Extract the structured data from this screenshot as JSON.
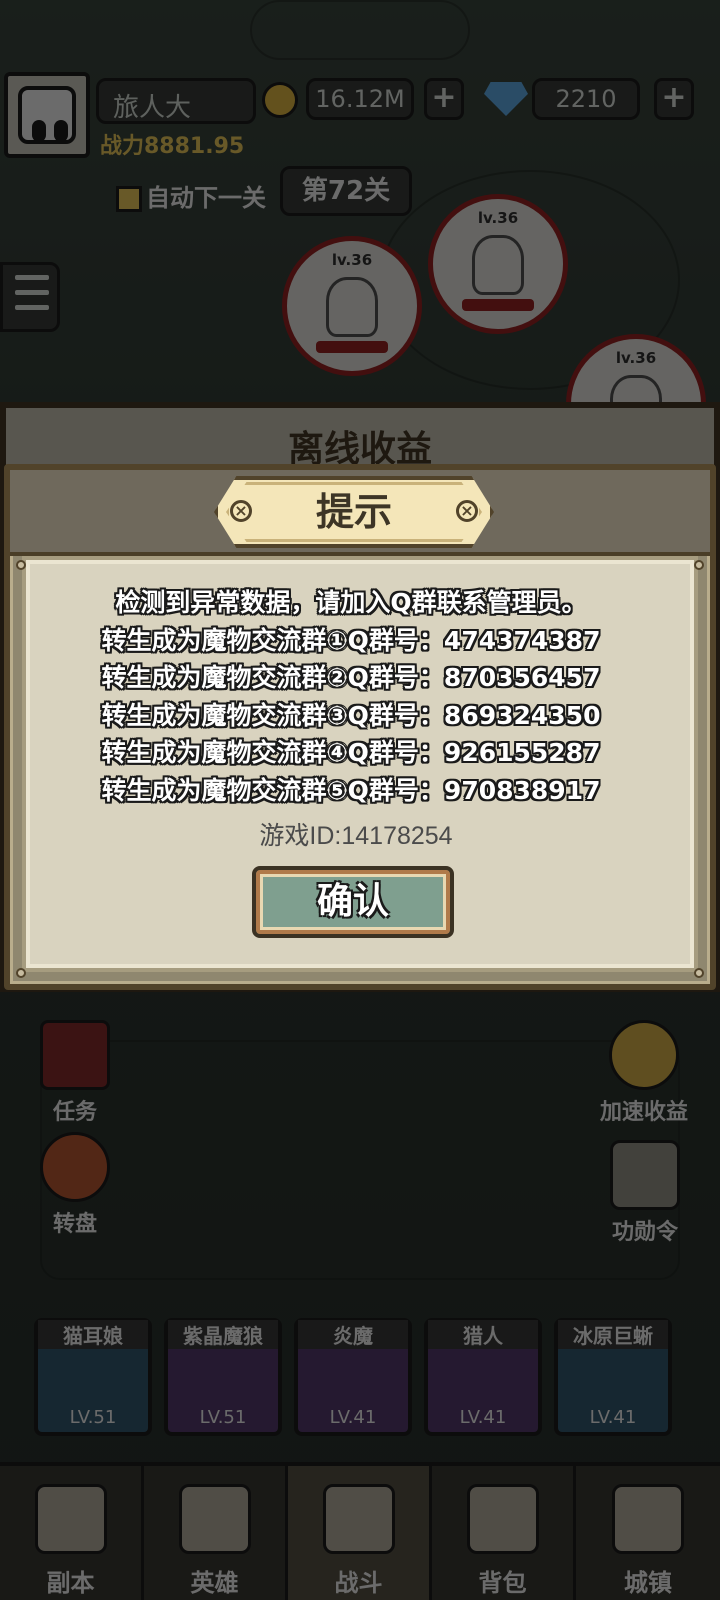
{
  "background": {
    "player_name": "旅人大",
    "gold": "16.12M",
    "gems": "2210",
    "combat_power": "战力8881.95",
    "auto_next_label": "自动下一关",
    "stage": "第72关",
    "enemy_levels": [
      "lv.36",
      "lv.36",
      "lv.36"
    ],
    "offline_panel_title": "离线收益",
    "side_left": [
      {
        "label": "任务",
        "icon": "task-book-icon"
      },
      {
        "label": "转盘",
        "icon": "wheel-icon"
      }
    ],
    "side_right": [
      {
        "label": "加速收益",
        "icon": "speed-coin-icon"
      },
      {
        "label": "功勋令",
        "icon": "helmet-icon"
      }
    ],
    "heroes": [
      {
        "name": "猫耳娘",
        "level": "LV.51"
      },
      {
        "name": "紫晶魔狼",
        "level": "LV.51"
      },
      {
        "name": "炎魔",
        "level": "LV.41"
      },
      {
        "name": "猎人",
        "level": "LV.41"
      },
      {
        "name": "冰原巨蜥",
        "level": "LV.41"
      }
    ],
    "tabs": [
      {
        "label": "副本",
        "icon": "dungeon-map-icon"
      },
      {
        "label": "英雄",
        "icon": "hero-helmet-icon"
      },
      {
        "label": "战斗",
        "icon": "crossed-swords-icon"
      },
      {
        "label": "背包",
        "icon": "backpack-icon"
      },
      {
        "label": "城镇",
        "icon": "town-icon"
      }
    ],
    "active_tab": 2
  },
  "dialog": {
    "title": "提示",
    "lines": [
      "检测到异常数据，请加入Q群联系管理员。",
      "转生成为魔物交流群①Q群号：474374387",
      "转生成为魔物交流群②Q群号：870356457",
      "转生成为魔物交流群③Q群号：869324350",
      "转生成为魔物交流群④Q群号：926155287",
      "转生成为魔物交流群⑤Q群号：970838917"
    ],
    "game_id": "游戏ID:14178254",
    "confirm_label": "确认"
  },
  "colors": {
    "dialog_bg": "#d9d3bf",
    "dialog_frame": "#51432a",
    "confirm_bg": "#7f9f8f",
    "enemy_ring": "#b11e1e"
  }
}
